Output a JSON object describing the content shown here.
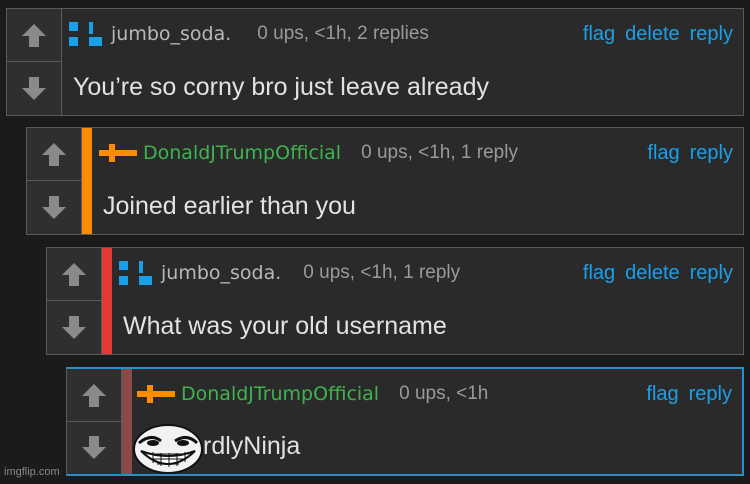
{
  "comments": [
    {
      "username": "jumbo_soda.",
      "meta": "0 ups, <1h, 2 replies",
      "actions": [
        "flag",
        "delete",
        "reply"
      ],
      "text": "You’re so corny bro just leave already"
    },
    {
      "username": "DonaldJTrumpOfficial",
      "meta": "0 ups, <1h, 1 reply",
      "actions": [
        "flag",
        "reply"
      ],
      "text": "Joined earlier than you",
      "stripe_color": "#ff8c00"
    },
    {
      "username": "jumbo_soda.",
      "meta": "0 ups, <1h, 1 reply",
      "actions": [
        "flag",
        "delete",
        "reply"
      ],
      "text": "What was your old username",
      "stripe_color": "#e53935"
    },
    {
      "username": "DonaldJTrumpOfficial",
      "meta": "0 ups, <1h",
      "actions": [
        "flag",
        "reply"
      ],
      "text": "rdlyNinja",
      "stripe_color": "#8a4a4a",
      "border_color": "#2a8fc8"
    }
  ],
  "watermark": "imgflip.com",
  "colors": {
    "link": "#1aa0e8",
    "green_user": "#3fb34f",
    "jumbo_icon": "#1aa0e8",
    "trump_icon": "#ff8c00"
  },
  "icons": {
    "upvote": "up-arrow-icon",
    "downvote": "down-arrow-icon",
    "jumbo_avatar": "blue-squares-icon",
    "trump_avatar": "orange-cross-icon",
    "overlay": "troll-face-icon"
  }
}
